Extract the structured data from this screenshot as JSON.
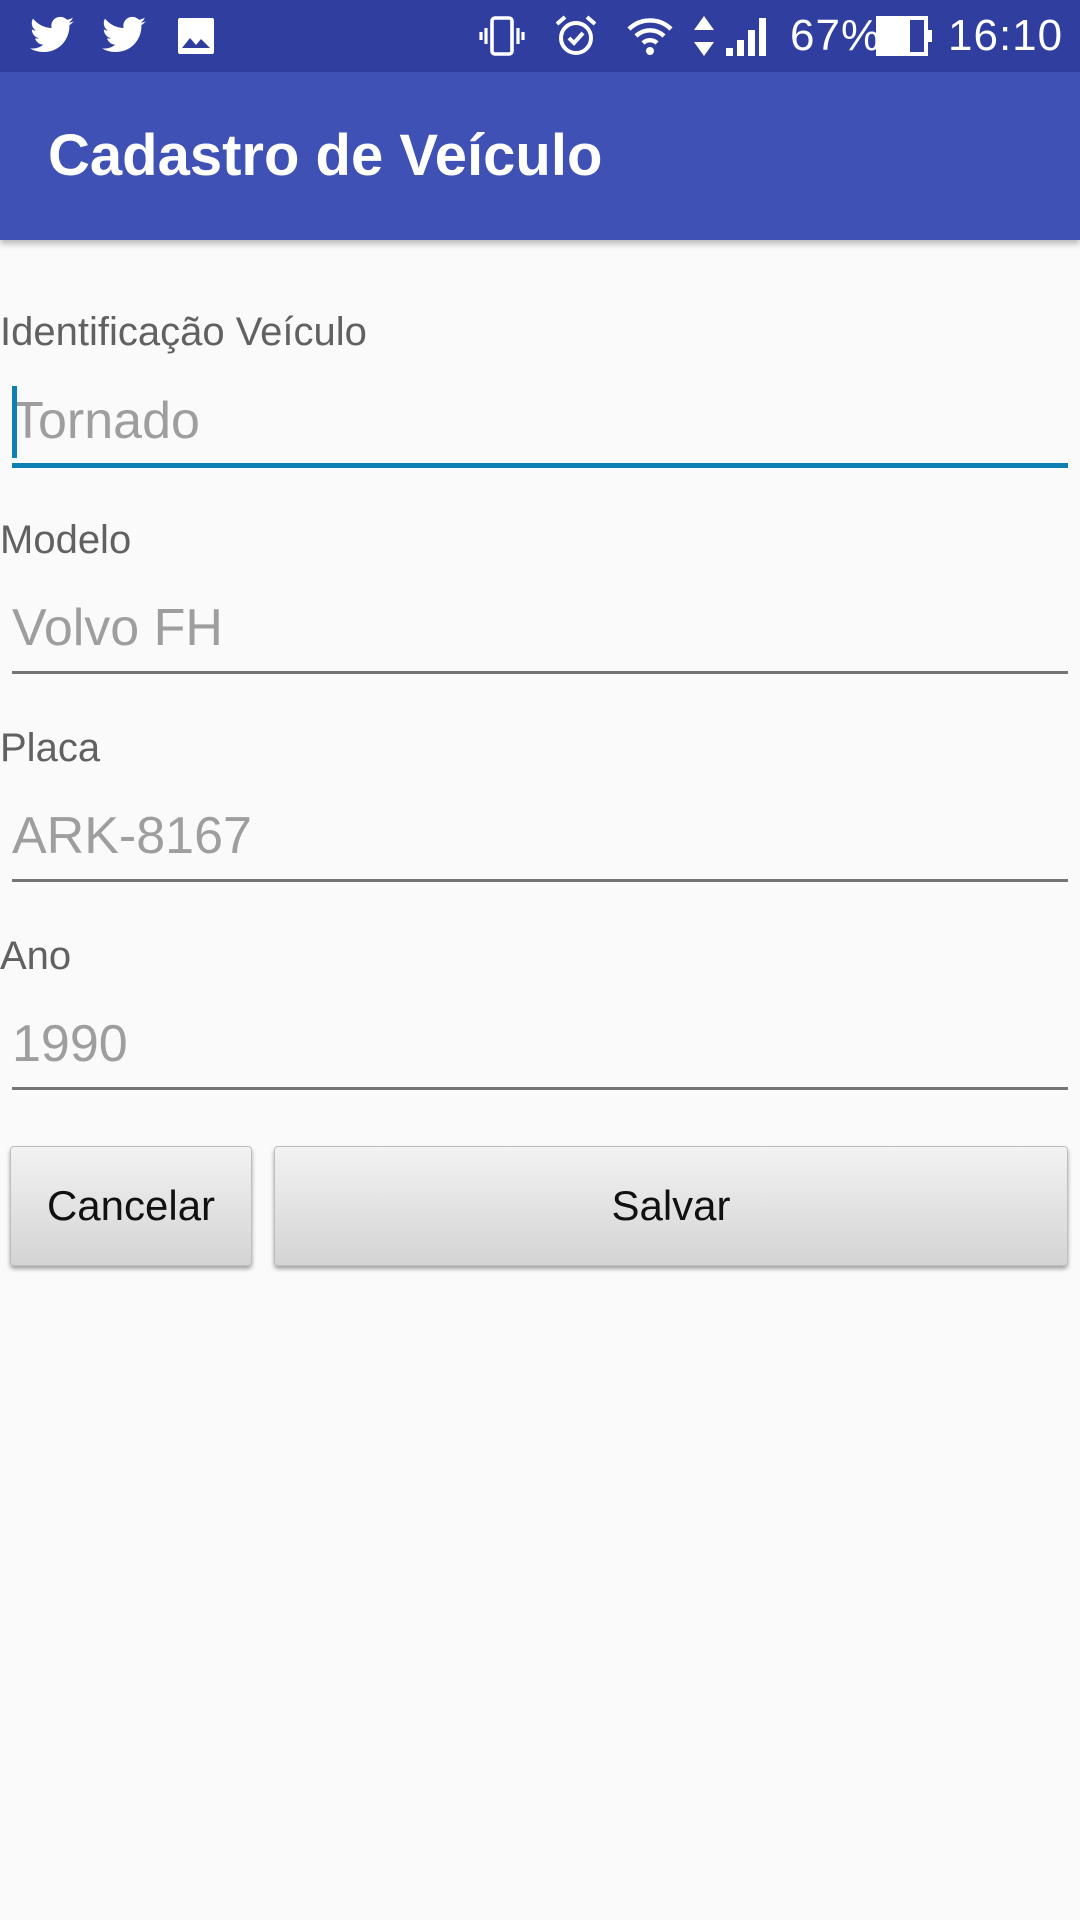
{
  "status_bar": {
    "notification_icons": [
      "twitter-icon",
      "twitter-icon",
      "image-icon"
    ],
    "system_icons": [
      "vibrate-icon",
      "alarm-icon",
      "wifi-icon",
      "data-arrows-icon",
      "signal-icon",
      "battery-icon"
    ],
    "battery_percent": "67%",
    "time": "16:10",
    "background_color": "#303f9f"
  },
  "app_bar": {
    "title": "Cadastro de Veículo",
    "background_color": "#3f51b5"
  },
  "form": {
    "fields": [
      {
        "label": "Identificação Veículo",
        "placeholder": "Tornado",
        "value": "",
        "focused": true
      },
      {
        "label": "Modelo",
        "placeholder": "Volvo FH",
        "value": ""
      },
      {
        "label": "Placa",
        "placeholder": "ARK-8167",
        "value": ""
      },
      {
        "label": "Ano",
        "placeholder": "1990",
        "value": ""
      }
    ],
    "accent_color": "#0d7fb0"
  },
  "buttons": {
    "cancel_label": "Cancelar",
    "save_label": "Salvar"
  }
}
